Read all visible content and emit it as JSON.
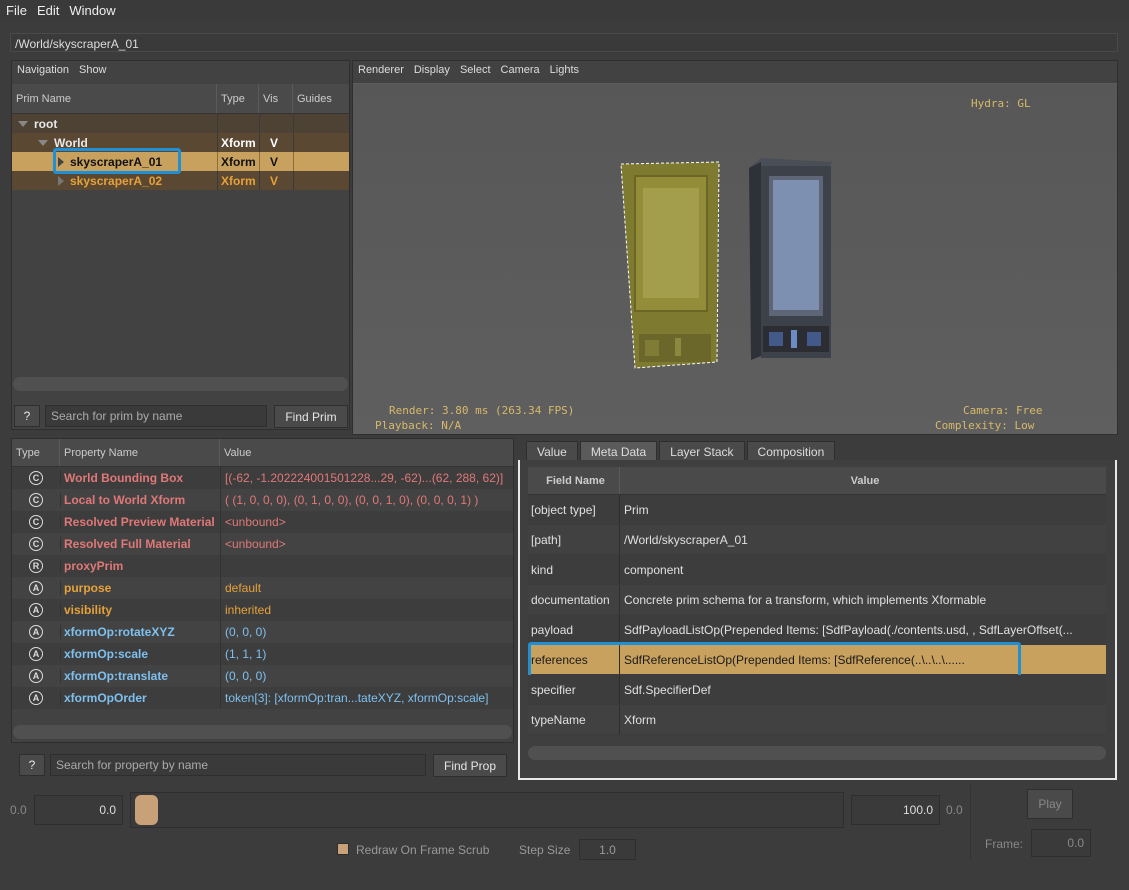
{
  "menu": [
    "File",
    "Edit",
    "Window"
  ],
  "path": "/World/skyscraperA_01",
  "tree_panel": {
    "menu": [
      "Navigation",
      "Show"
    ],
    "columns": [
      "Prim Name",
      "Type",
      "Vis",
      "Guides"
    ],
    "rows": [
      {
        "name": "root",
        "type": "",
        "vis": ""
      },
      {
        "name": "World",
        "type": "Xform",
        "vis": "V"
      },
      {
        "name": "skyscraperA_01",
        "type": "Xform",
        "vis": "V"
      },
      {
        "name": "skyscraperA_02",
        "type": "Xform",
        "vis": "V"
      }
    ],
    "help_label": "?",
    "search_placeholder": "Search for prim by name",
    "find_label": "Find Prim"
  },
  "viewport": {
    "menu": [
      "Renderer",
      "Display",
      "Select",
      "Camera",
      "Lights"
    ],
    "hydra": "Hydra: GL",
    "render_stats": "Render: 3.80 ms (263.34 FPS)",
    "playback": "Playback: N/A",
    "camera": "Camera: Free",
    "complexity": "Complexity: Low"
  },
  "properties": {
    "columns": [
      "Type",
      "Property Name",
      "Value"
    ],
    "rows": [
      {
        "icon": "C",
        "name": "World Bounding Box",
        "value": "[(-62, -1.202224001501228...29, -62)...(62, 288, 62)]",
        "color": "red"
      },
      {
        "icon": "C",
        "name": "Local to World Xform",
        "value": "( (1, 0, 0, 0), (0, 1, 0, 0), (0, 0, 1, 0), (0, 0, 0, 1) )",
        "color": "red"
      },
      {
        "icon": "C",
        "name": "Resolved Preview Material",
        "value": "<unbound>",
        "color": "red"
      },
      {
        "icon": "C",
        "name": "Resolved Full Material",
        "value": "<unbound>",
        "color": "red"
      },
      {
        "icon": "R",
        "name": "proxyPrim",
        "value": "",
        "color": "red"
      },
      {
        "icon": "A",
        "name": "purpose",
        "value": "default",
        "color": "orange"
      },
      {
        "icon": "A",
        "name": "visibility",
        "value": "inherited",
        "color": "orange"
      },
      {
        "icon": "A",
        "name": "xformOp:rotateXYZ",
        "value": "(0, 0, 0)",
        "color": "blue"
      },
      {
        "icon": "A",
        "name": "xformOp:scale",
        "value": "(1, 1, 1)",
        "color": "blue"
      },
      {
        "icon": "A",
        "name": "xformOp:translate",
        "value": "(0, 0, 0)",
        "color": "blue"
      },
      {
        "icon": "A",
        "name": "xformOpOrder",
        "value": "token[3]: [xformOp:tran...tateXYZ, xformOp:scale]",
        "color": "blue"
      }
    ],
    "help_label": "?",
    "search_placeholder": "Search for property by name",
    "find_label": "Find Prop"
  },
  "meta": {
    "tabs": [
      "Value",
      "Meta Data",
      "Layer Stack",
      "Composition"
    ],
    "columns": [
      "Field Name",
      "Value"
    ],
    "rows": [
      {
        "field": "[object type]",
        "value": "Prim"
      },
      {
        "field": "[path]",
        "value": "/World/skyscraperA_01"
      },
      {
        "field": "kind",
        "value": "component"
      },
      {
        "field": "documentation",
        "value": "Concrete prim schema for a transform, which implements Xformable"
      },
      {
        "field": "payload",
        "value": "SdfPayloadListOp(Prepended Items: [SdfPayload(./contents.usd, , SdfLayerOffset(..."
      },
      {
        "field": "references",
        "value": "SdfReferenceListOp(Prepended Items: [SdfReference(..\\..\\..\\......"
      },
      {
        "field": "specifier",
        "value": "Sdf.SpecifierDef"
      },
      {
        "field": "typeName",
        "value": "Xform"
      }
    ]
  },
  "timeline": {
    "start_label": "0.0",
    "start_value": "0.0",
    "end_value": "100.0",
    "end_label": "0.0",
    "play_label": "Play",
    "frame_label": "Frame:",
    "frame_value": "0.0",
    "redraw_label": "Redraw On Frame Scrub",
    "step_label": "Step Size",
    "step_value": "1.0",
    "scrub_position": 0
  },
  "colors": {
    "selection": "#c9a15e",
    "highlight_box": "#1f8fd6",
    "red": "#e07878",
    "orange": "#e6a23a",
    "blue": "#7ec0ef"
  }
}
